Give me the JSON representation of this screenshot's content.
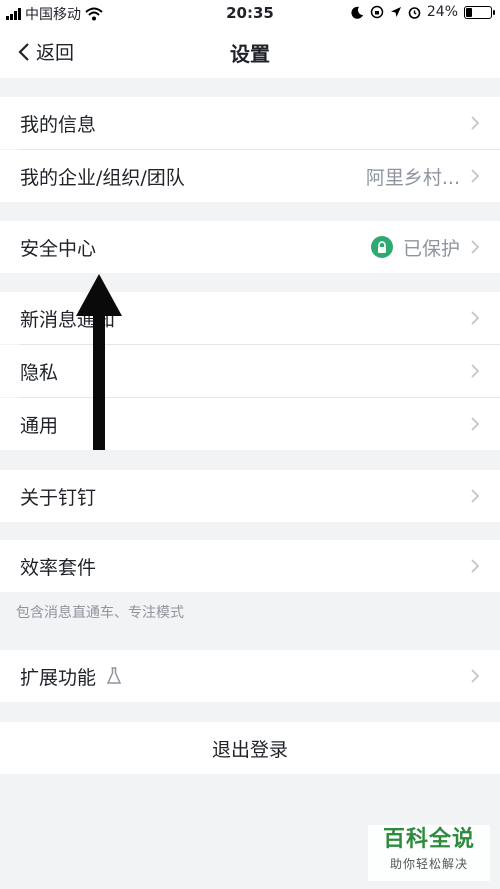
{
  "status_bar": {
    "carrier": "中国移动",
    "time": "20:35",
    "battery": "24%",
    "battery_level": 0.24
  },
  "nav": {
    "back_label": "返回",
    "title": "设置"
  },
  "cells": {
    "my_info": "我的信息",
    "my_org": "我的企业/组织/团队",
    "my_org_value": "阿里乡村...",
    "security": "安全中心",
    "security_value": "已保护",
    "notifications": "新消息通知",
    "privacy": "隐私",
    "general": "通用",
    "about": "关于钉钉",
    "efficiency": "效率套件",
    "efficiency_hint": "包含消息直通车、专注模式",
    "extensions": "扩展功能"
  },
  "logout_label": "退出登录",
  "watermark": {
    "title": "百科全说",
    "subtitle": "助你轻松解决"
  },
  "colors": {
    "background": "#f2f3f5",
    "shield_green": "#2ea970",
    "watermark_green": "#2e8b3d"
  }
}
